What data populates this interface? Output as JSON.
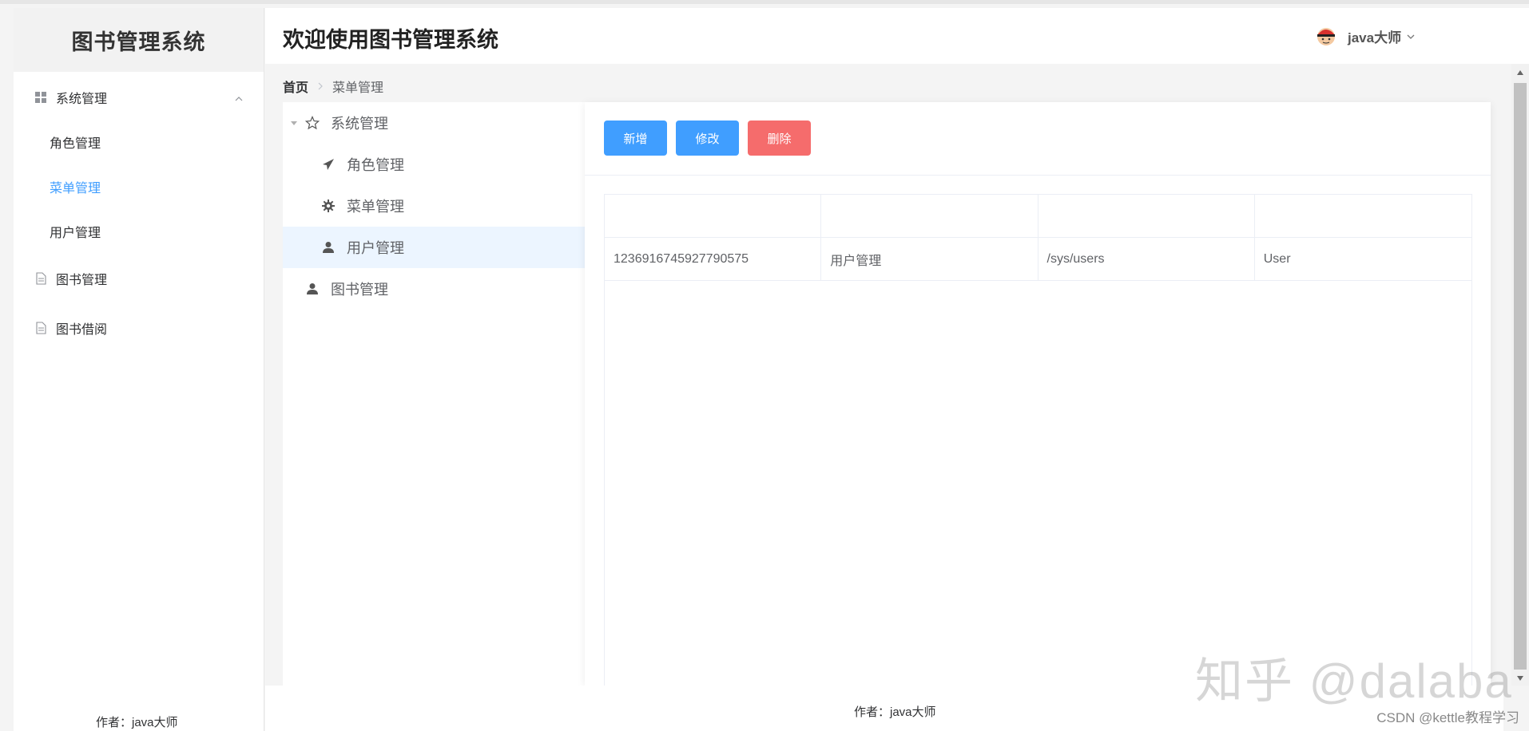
{
  "sidebar": {
    "logo_title": "图书管理系统",
    "groups": [
      {
        "label": "系统管理",
        "icon": "grid-icon",
        "expanded": true,
        "children": [
          {
            "label": "角色管理",
            "active": false
          },
          {
            "label": "菜单管理",
            "active": true
          },
          {
            "label": "用户管理",
            "active": false
          }
        ]
      },
      {
        "label": "图书管理",
        "icon": "document-icon"
      },
      {
        "label": "图书借阅",
        "icon": "document-icon"
      }
    ],
    "author": "作者：java大师"
  },
  "header": {
    "title": "欢迎使用图书管理系统",
    "user_name": "java大师"
  },
  "breadcrumb": {
    "home": "首页",
    "current": "菜单管理"
  },
  "tree": {
    "root": {
      "label": "系统管理",
      "icon": "star-icon"
    },
    "children": [
      {
        "label": "角色管理",
        "icon": "send-icon"
      },
      {
        "label": "菜单管理",
        "icon": "gear-icon"
      },
      {
        "label": "用户管理",
        "icon": "user-icon",
        "selected": true
      }
    ],
    "root2": {
      "label": "图书管理",
      "icon": "user-icon"
    }
  },
  "toolbar": {
    "add_label": "新增",
    "edit_label": "修改",
    "delete_label": "删除"
  },
  "table": {
    "headers": [
      "",
      "",
      "",
      ""
    ],
    "rows": [
      [
        "1236916745927790575",
        "用户管理",
        "/sys/users",
        "User"
      ]
    ]
  },
  "footer": {
    "author": "作者：java大师"
  },
  "watermarks": {
    "zhihu": "知乎 @dalaba",
    "csdn": "CSDN @kettle教程学习"
  },
  "colors": {
    "primary": "#409eff",
    "danger": "#f56c6c",
    "active_menu": "#409eff"
  }
}
